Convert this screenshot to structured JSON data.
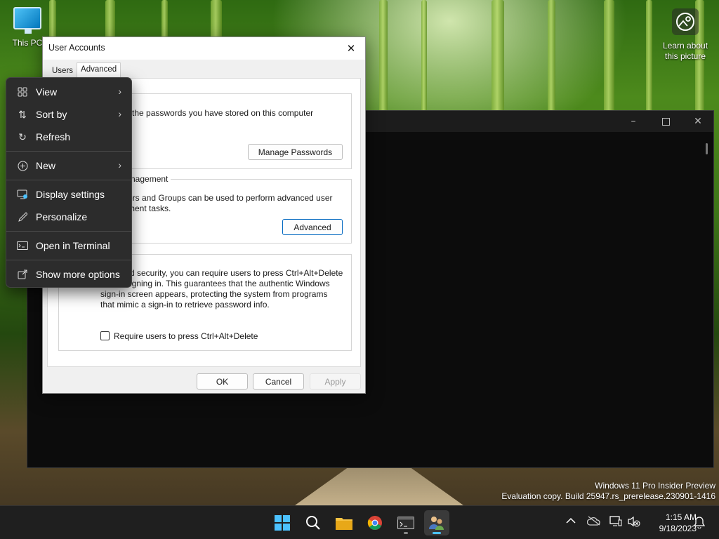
{
  "desktop": {
    "this_pc_label": "This PC",
    "learn_line1": "Learn about",
    "learn_line2": "this picture"
  },
  "dialog": {
    "title": "User Accounts",
    "tabs": [
      {
        "label": "Users"
      },
      {
        "label": "Advanced"
      }
    ],
    "passwords_text": "the passwords you have stored on this computer",
    "manage_passwords_label": "Manage Passwords",
    "management_group_title": "nagement",
    "management_line1": "ers and Groups can be used to perform advanced user",
    "management_line2": "ment tasks.",
    "advanced_button_label": "Advanced",
    "security_line1": "d security, you can require users to press Ctrl+Alt+Delete",
    "security_line2": "igning in. This guarantees that the authentic Windows",
    "security_line3": "sign-in screen appears, protecting the system from programs",
    "security_line4": "that mimic a sign-in to retrieve password info.",
    "checkbox_label": "Require users to press Ctrl+Alt+Delete",
    "ok_label": "OK",
    "cancel_label": "Cancel",
    "apply_label": "Apply"
  },
  "context_menu": {
    "items": [
      {
        "label": "View"
      },
      {
        "label": "Sort by"
      },
      {
        "label": "Refresh"
      },
      {
        "label": "New"
      },
      {
        "label": "Display settings"
      },
      {
        "label": "Personalize"
      },
      {
        "label": "Open in Terminal"
      },
      {
        "label": "Show more options"
      }
    ]
  },
  "watermark": {
    "line1": "Windows 11 Pro Insider Preview",
    "line2": "Evaluation copy. Build 25947.rs_prerelease.230901-1416"
  },
  "taskbar": {
    "time": "1:15 AM",
    "date": "9/18/2023"
  },
  "colors": {
    "accent": "#0067c0",
    "taskbar_indicator": "#4cc2ff"
  }
}
